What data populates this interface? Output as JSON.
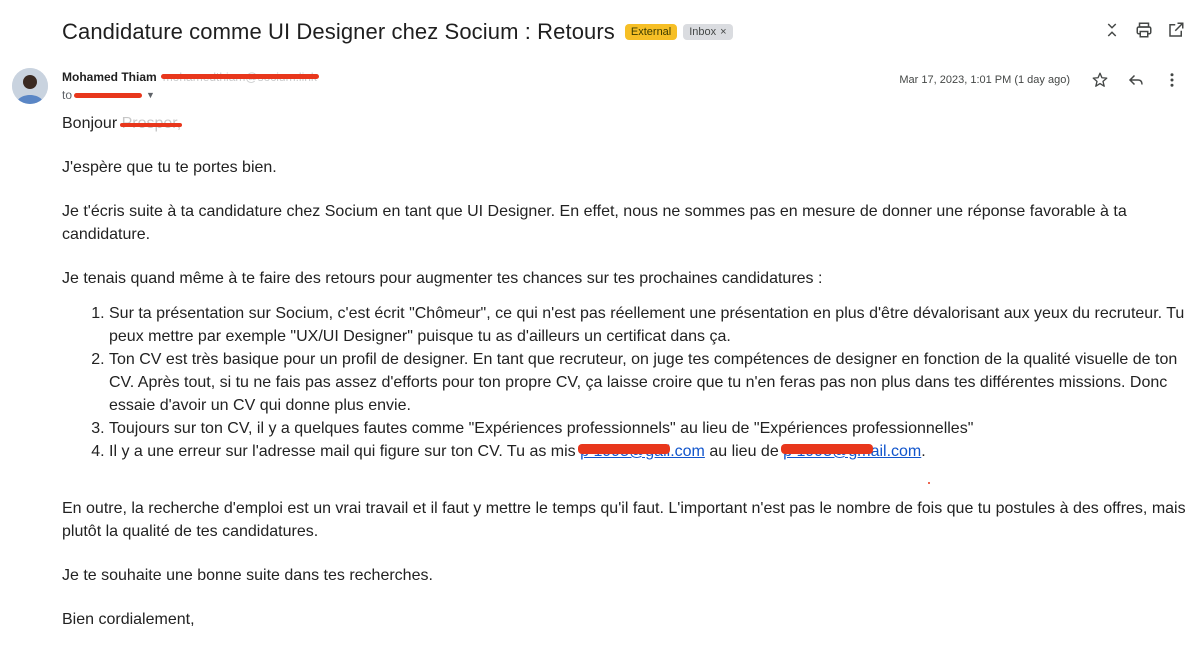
{
  "email": {
    "subject": "Candidature comme UI Designer chez Socium : Retours",
    "labels": {
      "external": "External",
      "inbox": "Inbox",
      "inbox_remove": "×"
    },
    "sender": {
      "name": "Mohamed Thiam",
      "email": "mohamedthiam@socium.link"
    },
    "to_prefix": "to",
    "date": "Mar 17, 2023, 1:01 PM (1 day ago)"
  },
  "icons": {
    "collapse": "unfold-less-icon",
    "print": "print-icon",
    "open_new": "open-in-new-icon",
    "star": "star-icon",
    "reply": "reply-icon",
    "more": "more-vert-icon"
  },
  "colors": {
    "external_label": "#f6bf26",
    "link": "#1155cc",
    "redaction": "#e8371c"
  },
  "body": {
    "greeting_prefix": "Bonjour ",
    "greeting_hidden": "Prosper,",
    "p1": "J'espère que tu te portes bien.",
    "p2": "Je t'écris suite à ta candidature chez Socium en tant que UI Designer. En effet, nous ne sommes pas en mesure de donner une réponse favorable à ta candidature.",
    "p3": "Je tenais quand même à te faire des retours pour augmenter tes chances sur tes prochaines candidatures :",
    "items": [
      "Sur ta présentation sur Socium, c'est écrit \"Chômeur\", ce qui n'est pas réellement une présentation en plus d'être dévalorisant aux yeux du recruteur. Tu peux mettre par exemple \"UX/UI Designer\" puisque tu as d'ailleurs un certificat dans ça.",
      "Ton CV est très basique pour un profil de designer. En tant que recruteur, on juge tes compétences de designer en fonction de la qualité visuelle de ton CV. Après tout, si tu ne fais pas assez d'efforts pour ton propre CV, ça laisse croire que tu n'en feras pas non plus dans tes différentes missions. Donc essaie d'avoir un CV qui donne plus envie.",
      "Toujours sur ton CV, il y a quelques fautes comme \"Expériences professionnels\" au lieu de \"Expériences professionnelles\""
    ],
    "item4_prefix": "Il y a une erreur sur l'adresse mail qui figure sur ton CV. Tu as mis ",
    "item4_link1": "p          1995@gail.com",
    "item4_middle": " au lieu de ",
    "item4_link2": "p          1995@gmail.com",
    "item4_suffix": ".",
    "p4": "En outre, la recherche d'emploi est un vrai travail et il faut y mettre le temps qu'il faut. L'important n'est pas le nombre de fois que tu postules à des offres, mais plutôt la qualité de tes candidatures.",
    "p5": "Je te souhaite une bonne suite dans tes recherches.",
    "closing": "Bien cordialement,"
  }
}
